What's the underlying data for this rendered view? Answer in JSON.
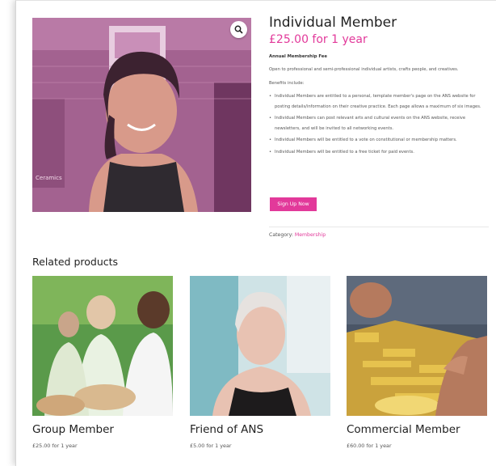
{
  "product": {
    "title": "Individual Member",
    "price": "£25.00 for 1 year",
    "fee_title": "Annual Membership Fee",
    "description": "Open to professional and semi-professional individual artists, crafts people, and creatives.",
    "benefits_label": "Benefits include:",
    "benefits": [
      "Individual Members are entitled to a personal, template member's page on the ANS website for posting details/information on their creative practice. Each page allows a maximum of six images.",
      "Individual Members can post relevant arts and cultural events on the ANS website, receive newsletters, and will be invited to all networking events.",
      "Individual Members will be entitled to a vote on constitutional or membership matters.",
      "Individual Members will be entitled to a free ticket for paid events."
    ],
    "signup_label": "Sign Up Now",
    "category_label": "Category:",
    "category_value": "Membership",
    "image_text": "Ceramics"
  },
  "related": {
    "heading": "Related products",
    "items": [
      {
        "name": "Group Member",
        "price": "£25.00 for 1 year"
      },
      {
        "name": "Friend of ANS",
        "price": "£5.00 for 1 year"
      },
      {
        "name": "Commercial Member",
        "price": "£60.00 for 1 year"
      }
    ]
  },
  "colors": {
    "accent": "#e2399a",
    "text": "#222222"
  },
  "icons": {
    "zoom": "search-icon"
  }
}
